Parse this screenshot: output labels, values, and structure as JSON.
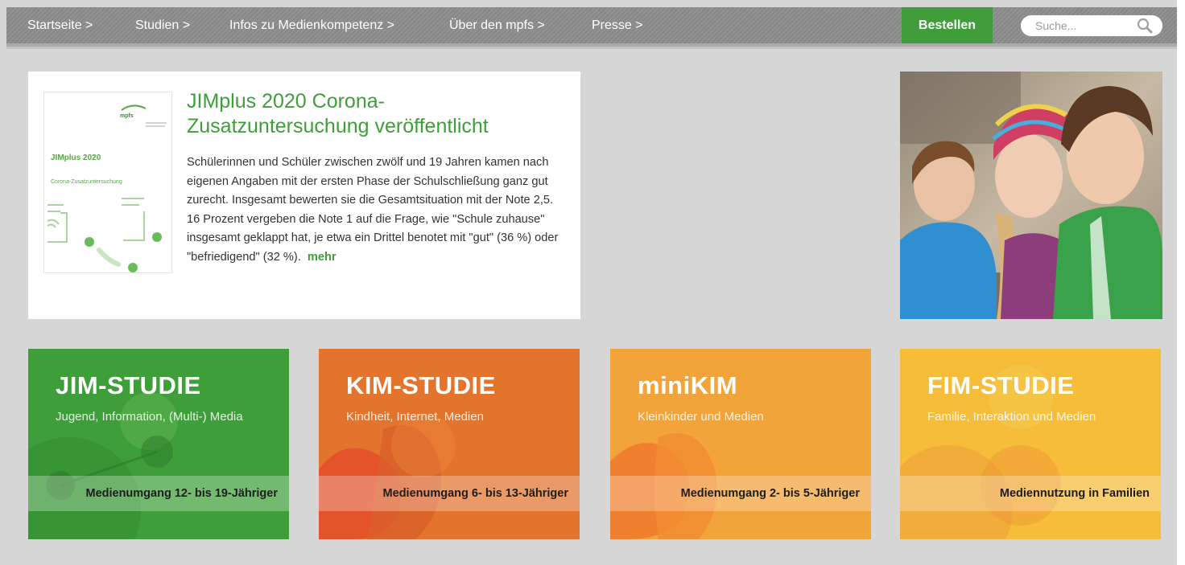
{
  "nav": {
    "items": [
      {
        "label": "Startseite >"
      },
      {
        "label": "Studien >"
      },
      {
        "label": "Infos zu Medienkompetenz >"
      },
      {
        "label": "Über den mpfs >"
      },
      {
        "label": "Presse >"
      }
    ],
    "order_label": "Bestellen",
    "search_placeholder": "Suche...",
    "accent": "#3f9e3a"
  },
  "news": {
    "cover": {
      "logo": "mpfs",
      "title": "JIMplus 2020",
      "subtitle": "Corona-Zusatzuntersuchung"
    },
    "title": "JIMplus 2020 Corona-Zusatzuntersuchung veröffentlicht",
    "text": "Schülerinnen und Schüler zwischen zwölf und 19 Jahren kamen nach eigenen Angaben mit der ersten Phase der Schulschließung ganz gut zurecht. Insgesamt bewerten sie die Gesamtsituation mit der Note 2,5. 16 Prozent vergeben die Note 1 auf die Frage, wie \"Schule zuhause\" insgesamt geklappt hat, je etwa ein Drittel benotet mit \"gut\" (36 %) oder \"befriedigend\" (32 %).",
    "more": "mehr"
  },
  "studies": [
    {
      "title": "JIM-STUDIE",
      "subtitle": "Jugend, Information, (Multi-) Media",
      "band": "Medienumgang 12- bis 19-Jähriger",
      "color": "#3e9e39"
    },
    {
      "title": "KIM-STUDIE",
      "subtitle": "Kindheit, Internet, Medien",
      "band": "Medienumgang 6- bis 13-Jähriger",
      "color": "#e2742d"
    },
    {
      "title": "miniKIM",
      "subtitle": "Kleinkinder und Medien",
      "band": "Medienumgang 2- bis 5-Jähriger",
      "color": "#f2a33a"
    },
    {
      "title": "FIM-STUDIE",
      "subtitle": "Familie, Interaktion und Medien",
      "band": "Mediennutzung in Familien",
      "color": "#f5bd3a"
    }
  ]
}
